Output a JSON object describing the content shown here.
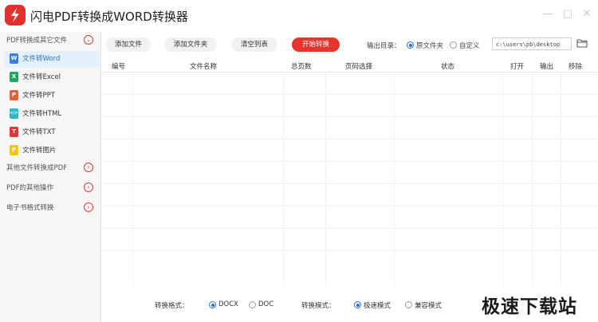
{
  "app": {
    "title": "闪电PDF转换成WORD转换器",
    "minimize": "—",
    "maximize": "□",
    "close": "✕"
  },
  "sidebar": {
    "groups": [
      {
        "label": "PDF转换成其它文件",
        "state": "expanded"
      },
      {
        "label": "其他文件转换成PDF",
        "state": "collapsed"
      },
      {
        "label": "PDF的其他操作",
        "state": "collapsed"
      },
      {
        "label": "电子书格式转换",
        "state": "collapsed"
      }
    ],
    "items": [
      {
        "label": "文件转Word",
        "badge": "W",
        "color": "#3b7de0",
        "active": true
      },
      {
        "label": "文件转Excel",
        "badge": "X",
        "color": "#22a463",
        "active": false
      },
      {
        "label": "文件转PPT",
        "badge": "P",
        "color": "#e2603a",
        "active": false
      },
      {
        "label": "文件转HTML",
        "badge": "</>",
        "color": "#2fb8c4",
        "active": false
      },
      {
        "label": "文件转TXT",
        "badge": "T",
        "color": "#d83a3a",
        "active": false
      },
      {
        "label": "文件转图片",
        "badge": "P",
        "color": "#f0c419",
        "active": false
      }
    ]
  },
  "toolbar": {
    "add_file": "添加文件",
    "add_folder": "添加文件夹",
    "clear_list": "清空列表",
    "start": "开始转换",
    "output_label": "输出目录：",
    "opt_original": "原文件夹",
    "opt_custom": "自定义",
    "path": "c:\\users\\pb\\desktop"
  },
  "table": {
    "columns": [
      "编号",
      "文件名称",
      "总页数",
      "页码选择",
      "状态",
      "打开",
      "输出",
      "移除"
    ],
    "rows": []
  },
  "footer": {
    "format_label": "转换格式：",
    "docx": "DOCX",
    "doc": "DOC",
    "mode_label": "转换模式：",
    "fast": "极速模式",
    "compat": "兼容模式"
  },
  "watermark": "极速下载站",
  "colors": {
    "accent": "#e8342e",
    "selected_bg": "#e4f0fb",
    "radio": "#2a6fd6"
  }
}
